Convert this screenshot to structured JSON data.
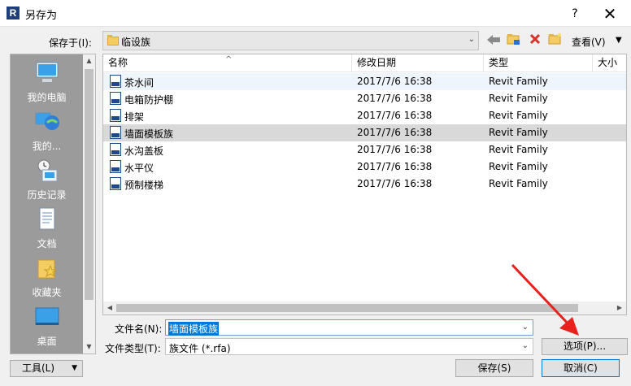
{
  "window": {
    "title": "另存为",
    "help": "?",
    "close": "✕",
    "app_icon": "R"
  },
  "toolbar": {
    "save_in_label": "保存于(I):",
    "location": "临设族",
    "view_label": "查看(V)"
  },
  "places": [
    {
      "label": "我的电脑",
      "icon": "computer-icon"
    },
    {
      "label": "我的...",
      "icon": "network-icon"
    },
    {
      "label": "历史记录",
      "icon": "history-icon"
    },
    {
      "label": "文档",
      "icon": "document-icon"
    },
    {
      "label": "收藏夹",
      "icon": "favorites-icon"
    },
    {
      "label": "桌面",
      "icon": "desktop-icon"
    }
  ],
  "columns": {
    "name": "名称",
    "date": "修改日期",
    "type": "类型",
    "size": "大小"
  },
  "files": [
    {
      "name": "茶水间",
      "date": "2017/7/6 16:38",
      "type": "Revit Family"
    },
    {
      "name": "电箱防护棚",
      "date": "2017/7/6 16:38",
      "type": "Revit Family"
    },
    {
      "name": "排架",
      "date": "2017/7/6 16:38",
      "type": "Revit Family"
    },
    {
      "name": "墙面模板族",
      "date": "2017/7/6 16:38",
      "type": "Revit Family"
    },
    {
      "name": "水沟盖板",
      "date": "2017/7/6 16:38",
      "type": "Revit Family"
    },
    {
      "name": "水平仪",
      "date": "2017/7/6 16:38",
      "type": "Revit Family"
    },
    {
      "name": "预制楼梯",
      "date": "2017/7/6 16:38",
      "type": "Revit Family"
    }
  ],
  "form": {
    "filename_label": "文件名(N):",
    "filename_value": "墙面模板族",
    "filetype_label": "文件类型(T):",
    "filetype_value": "族文件 (*.rfa)"
  },
  "buttons": {
    "tools": "工具(L)",
    "options": "选项(P)...",
    "save": "保存(S)",
    "cancel": "取消(C)"
  },
  "colors": {
    "accent": "#0078d7",
    "sidebar": "#9b9b9b",
    "arrow": "#e8211d"
  }
}
